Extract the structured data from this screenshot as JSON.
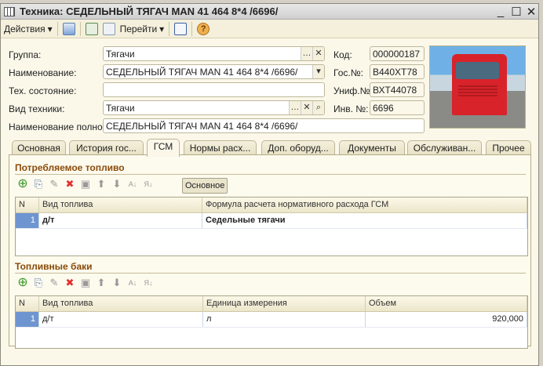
{
  "window": {
    "title": "Техника: СЕДЕЛЬНЫЙ ТЯГАЧ MAN 41 464 8*4 /6696/",
    "minimize": "_",
    "maximize": "☐",
    "close": "✕"
  },
  "toolbar": {
    "actions": "Действия",
    "goto": "Перейти"
  },
  "form": {
    "group_label": "Группа:",
    "group": "Тягачи",
    "name_label": "Наименование:",
    "name": "СЕДЕЛЬНЫЙ ТЯГАЧ MAN 41 464 8*4 /6696/",
    "state_label": "Тех. состояние:",
    "state": "",
    "type_label": "Вид техники:",
    "type": "Тягачи",
    "fullname_label": "Наименование полное:",
    "fullname": "СЕДЕЛЬНЫЙ ТЯГАЧ MAN 41 464 8*4 /6696/",
    "code_label": "Код:",
    "code": "000000187",
    "gos_label": "Гос.№:",
    "gos": "В440ХТ78",
    "unif_label": "Униф.№:",
    "unif": "ВХТ44078",
    "inv_label": "Инв. №:",
    "inv": "6696"
  },
  "tabs": [
    "Основная",
    "История гос...",
    "ГСМ",
    "Нормы расх...",
    "Доп. оборуд...",
    "Документы",
    "Обслуживан...",
    "Прочее"
  ],
  "active_tab": "ГСМ",
  "fuel": {
    "title": "Потребляемое топливо",
    "osn_button": "Основное",
    "columns": [
      "N",
      "Вид топлива",
      "Формула расчета нормативного расхода ГСМ"
    ],
    "rows": [
      [
        "1",
        "д/т",
        "Седельные тягачи"
      ]
    ]
  },
  "tanks": {
    "title": "Топливные баки",
    "columns": [
      "N",
      "Вид топлива",
      "Единица измерения",
      "Объем"
    ],
    "rows": [
      [
        "1",
        "д/т",
        "л",
        "920,000"
      ]
    ]
  },
  "icons": {
    "add": "add-icon",
    "copy": "copy-icon",
    "edit": "pencil-icon",
    "delete": "delete-icon",
    "save": "save-icon",
    "up": "arrow-up-icon",
    "down": "arrow-down-icon",
    "sort_asc": "sort-asc-icon",
    "sort_desc": "sort-desc-icon"
  }
}
